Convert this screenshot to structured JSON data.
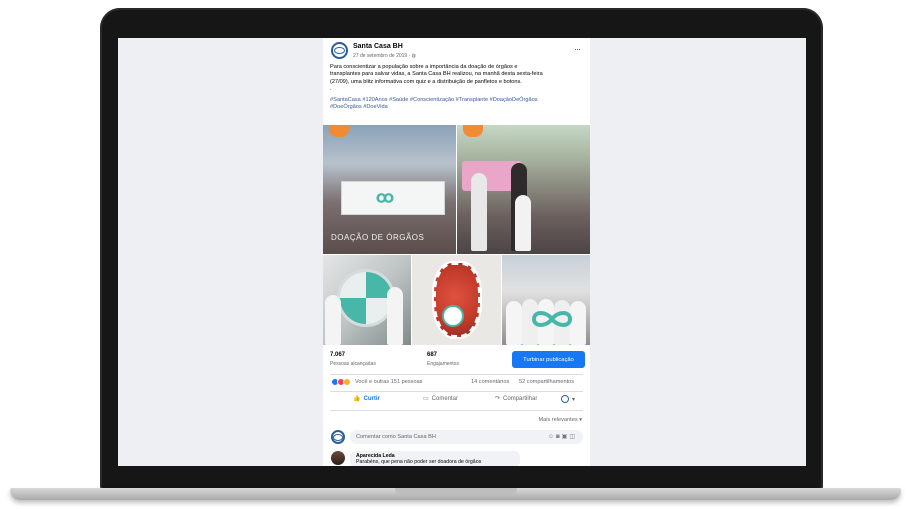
{
  "post": {
    "page_name": "Santa Casa BH",
    "date": "27 de setembro de 2019 · ",
    "more": "···",
    "text_lines": [
      "Para conscientizar a população sobre a importância da doação de órgãos e",
      "transplantes para salvar vidas, a Santa Casa BH realizou, na manhã desta sexta-feira",
      "(27/09), uma blitz informativa com quiz e a distribuição de panfletos e botons.",
      "."
    ],
    "hashtags_line1": "#SantaCasa #120Anos #Saúde #Conscientização #Transplante #DoaçãoDeÓrgãos",
    "hashtags_line2": "#DoeÓrgãos #DoeVida"
  },
  "photos": {
    "caption": "DOAÇÃO DE ÓRGÃOS"
  },
  "stats": {
    "reach_value": "7.067",
    "reach_label": "Pessoas alcançadas",
    "engagement_value": "687",
    "engagement_label": "Engajamentos",
    "boost_label": "Turbinar publicação"
  },
  "reactions": {
    "summary": "Você e outras 151 pessoas",
    "comments": "14 comentários",
    "shares": "52 compartilhamentos"
  },
  "actions": {
    "like": "Curtir",
    "comment": "Comentar",
    "share": "Compartilhar"
  },
  "filter": {
    "label": "Mais relevantes"
  },
  "composer": {
    "placeholder": "Comentar como Santa Casa BH"
  },
  "comment": {
    "author": "Aparecida Leda",
    "text": "Parabéns, que pena não poder ser doadora de órgãos"
  },
  "colors": {
    "facebook_blue": "#1877f2",
    "hashtag_blue": "#385898",
    "teal": "#49b7a8",
    "orange_badge": "#f08b34"
  }
}
